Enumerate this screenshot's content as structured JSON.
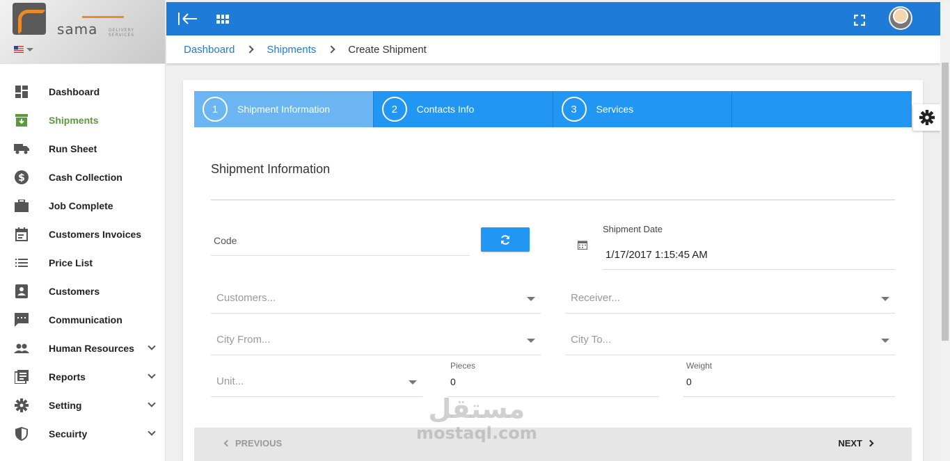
{
  "brand": {
    "logo_text": "sama",
    "logo_sub": "DELIVERY SERVICES"
  },
  "sidebar": {
    "items": [
      {
        "label": "Dashboard",
        "icon": "dashboard-icon"
      },
      {
        "label": "Shipments",
        "icon": "shipment-box-icon",
        "active": true
      },
      {
        "label": "Run Sheet",
        "icon": "truck-icon"
      },
      {
        "label": "Cash Collection",
        "icon": "dollar-circle-icon"
      },
      {
        "label": "Job Complete",
        "icon": "briefcase-icon"
      },
      {
        "label": "Customers Invoices",
        "icon": "calendar-icon"
      },
      {
        "label": "Price List",
        "icon": "list-icon"
      },
      {
        "label": "Customers",
        "icon": "contact-card-icon"
      },
      {
        "label": "Communication",
        "icon": "chat-icon"
      },
      {
        "label": "Human Resources",
        "icon": "people-icon",
        "expandable": true
      },
      {
        "label": "Reports",
        "icon": "reports-icon",
        "expandable": true
      },
      {
        "label": "Setting",
        "icon": "gear-icon",
        "expandable": true
      },
      {
        "label": "Secuirty",
        "icon": "shield-icon",
        "expandable": true
      }
    ]
  },
  "breadcrumb": {
    "items": [
      "Dashboard",
      "Shipments"
    ],
    "current": "Create Shipment"
  },
  "wizard": {
    "steps": [
      {
        "num": "1",
        "label": "Shipment Information",
        "active": true
      },
      {
        "num": "2",
        "label": "Contacts Info"
      },
      {
        "num": "3",
        "label": "Services"
      }
    ]
  },
  "form": {
    "section_title": "Shipment Information",
    "code_placeholder": "Code",
    "shipment_date_label": "Shipment Date",
    "shipment_date_value": "1/17/2017 1:15:45 AM",
    "customers_placeholder": "Customers...",
    "receiver_placeholder": "Receiver...",
    "city_from_placeholder": "City From...",
    "city_to_placeholder": "City To...",
    "unit_placeholder": "Unit...",
    "pieces_label": "Pieces",
    "pieces_value": "0",
    "weight_label": "Weight",
    "weight_value": "0"
  },
  "footer": {
    "previous": "PREVIOUS",
    "next": "NEXT"
  },
  "watermark": {
    "arabic": "مستقل",
    "english": "mostaql.com"
  },
  "colors": {
    "primary": "#2196f3",
    "topbar": "#1e7bd8",
    "active_green": "#5a9a3a"
  }
}
